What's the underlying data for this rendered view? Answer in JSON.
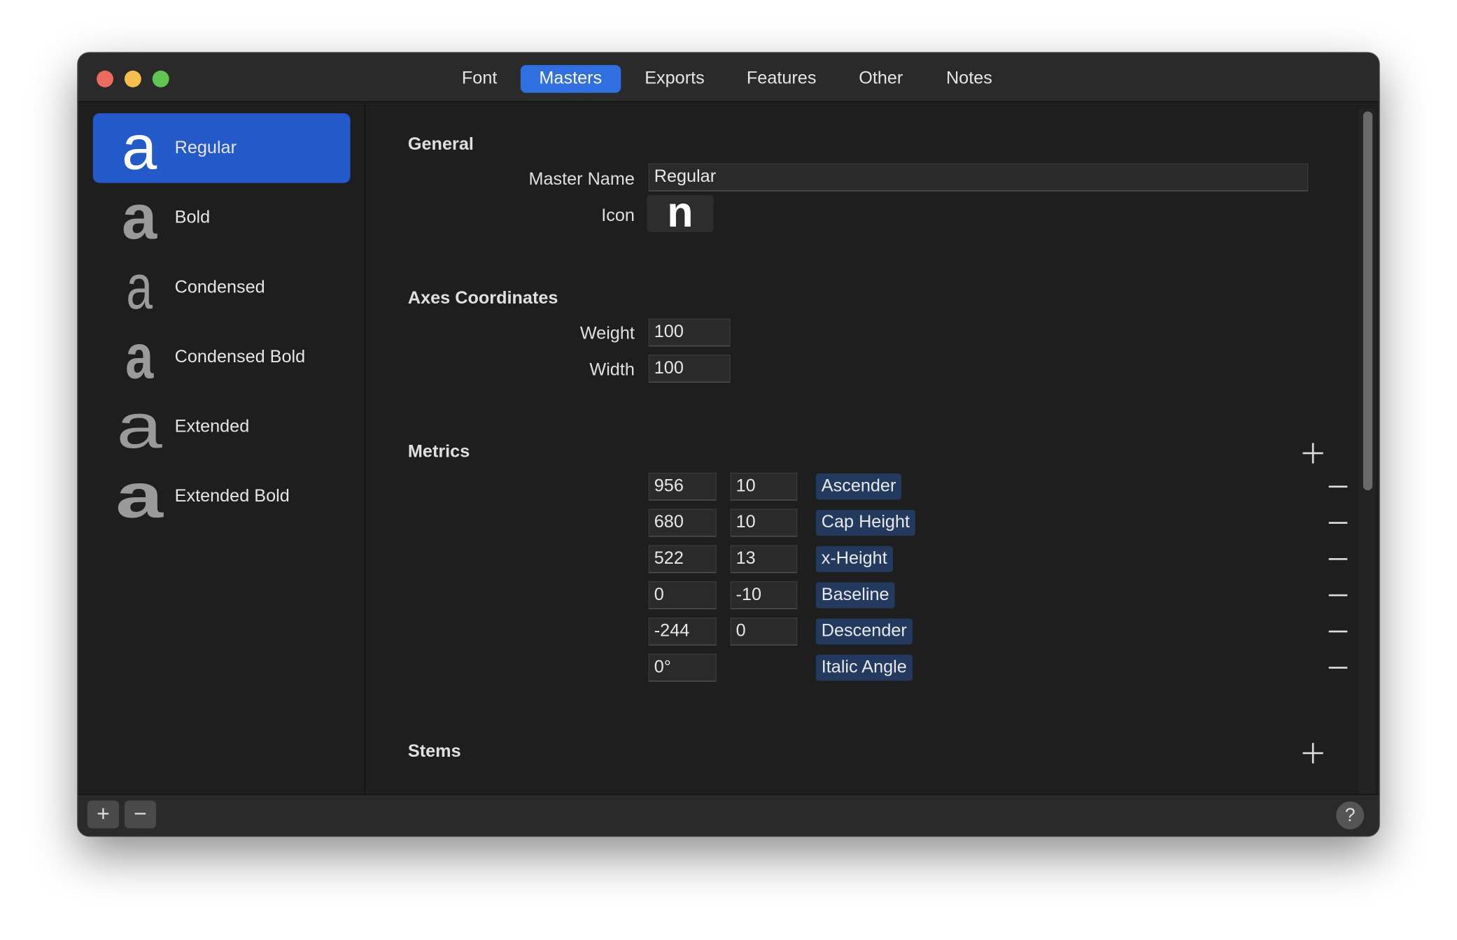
{
  "tabs": [
    {
      "label": "Font"
    },
    {
      "label": "Masters",
      "active": true
    },
    {
      "label": "Exports"
    },
    {
      "label": "Features"
    },
    {
      "label": "Other"
    },
    {
      "label": "Notes"
    }
  ],
  "masters": [
    {
      "glyph": "a",
      "name": "Regular",
      "selected": true
    },
    {
      "glyph": "a",
      "name": "Bold"
    },
    {
      "glyph": "a",
      "name": "Condensed"
    },
    {
      "glyph": "a",
      "name": "Condensed Bold"
    },
    {
      "glyph": "a",
      "name": "Extended"
    },
    {
      "glyph": "a",
      "name": "Extended Bold"
    }
  ],
  "general": {
    "title": "General",
    "master_name_label": "Master Name",
    "master_name": "Regular",
    "icon_label": "Icon",
    "icon_glyph": "n"
  },
  "axes": {
    "title": "Axes Coordinates",
    "weight_label": "Weight",
    "weight": "100",
    "width_label": "Width",
    "width": "100"
  },
  "metrics": {
    "title": "Metrics",
    "rows": [
      {
        "value": "956",
        "overshoot": "10",
        "name": "Ascender"
      },
      {
        "value": "680",
        "overshoot": "10",
        "name": "Cap Height"
      },
      {
        "value": "522",
        "overshoot": "13",
        "name": "x-Height"
      },
      {
        "value": "0",
        "overshoot": "-10",
        "name": "Baseline"
      },
      {
        "value": "-244",
        "overshoot": "0",
        "name": "Descender"
      },
      {
        "value": "0°",
        "overshoot": null,
        "name": "Italic Angle"
      }
    ]
  },
  "stems": {
    "title": "Stems"
  },
  "bottom": {
    "add": "+",
    "remove": "−",
    "help": "?"
  },
  "colors": {
    "accent": "#2f6fe0",
    "selection": "#2459c9",
    "tag": "#233a5e"
  }
}
